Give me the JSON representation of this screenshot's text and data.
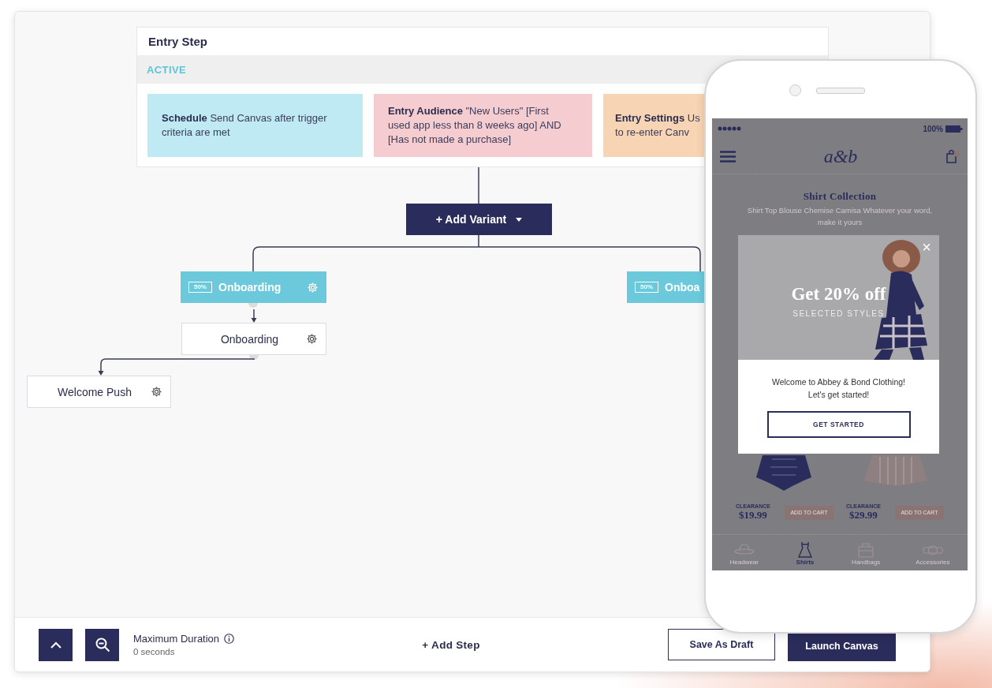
{
  "entry_step": {
    "title": "Entry Step",
    "status": "ACTIVE",
    "cards": [
      {
        "color": "#bfeaf3",
        "text": "**Schedule** Send Canvas after trigger\ncriteria are met"
      },
      {
        "color": "#f5cdd0",
        "text": "**Entry Audience** \"New Users\" [First\nused app less than 8 weeks ago] AND\n[Has not made a purchase]"
      },
      {
        "color": "#f7d4b4",
        "text": "**Entry Settings** Us\nto re-enter Canv"
      }
    ]
  },
  "add_variant": {
    "label": "+ Add Variant"
  },
  "variants": [
    {
      "share": "50%",
      "name": "Onboarding",
      "steps": [
        {
          "name": "Onboarding",
          "children": [
            {
              "name": "Welcome Push"
            }
          ]
        }
      ]
    },
    {
      "share": "50%",
      "name": "Onboa"
    }
  ],
  "bottom_bar": {
    "max_duration": {
      "label": "Maximum Duration",
      "value": "0 seconds"
    },
    "add_step": "+ Add Step",
    "save": "Save As Draft",
    "launch": "Launch Canvas"
  },
  "phone": {
    "battery": "100%",
    "logo": "a&b",
    "title": "Shirt Collection",
    "subtitle": "Shirt Top Blouse Chemise Camisa Whatever your word, make it yours",
    "popup": {
      "close": "×",
      "headline": "Get 20% off",
      "subhead": "SELECTED STYLES",
      "message": [
        "Welcome to Abbey & Bond Clothing!",
        "Let's get started!"
      ],
      "button": "GET STARTED"
    },
    "products": [
      {
        "tag": "CLEARANCE",
        "price": "$19.99",
        "button": "ADD TO CART"
      },
      {
        "tag": "CLEARANCE",
        "price": "$29.99",
        "button": "ADD TO CART"
      }
    ],
    "nav": [
      {
        "label": "Headwear",
        "selected": false
      },
      {
        "label": "Shirts",
        "selected": true
      },
      {
        "label": "Handbags",
        "selected": false
      },
      {
        "label": "Accessories",
        "selected": false
      }
    ]
  }
}
